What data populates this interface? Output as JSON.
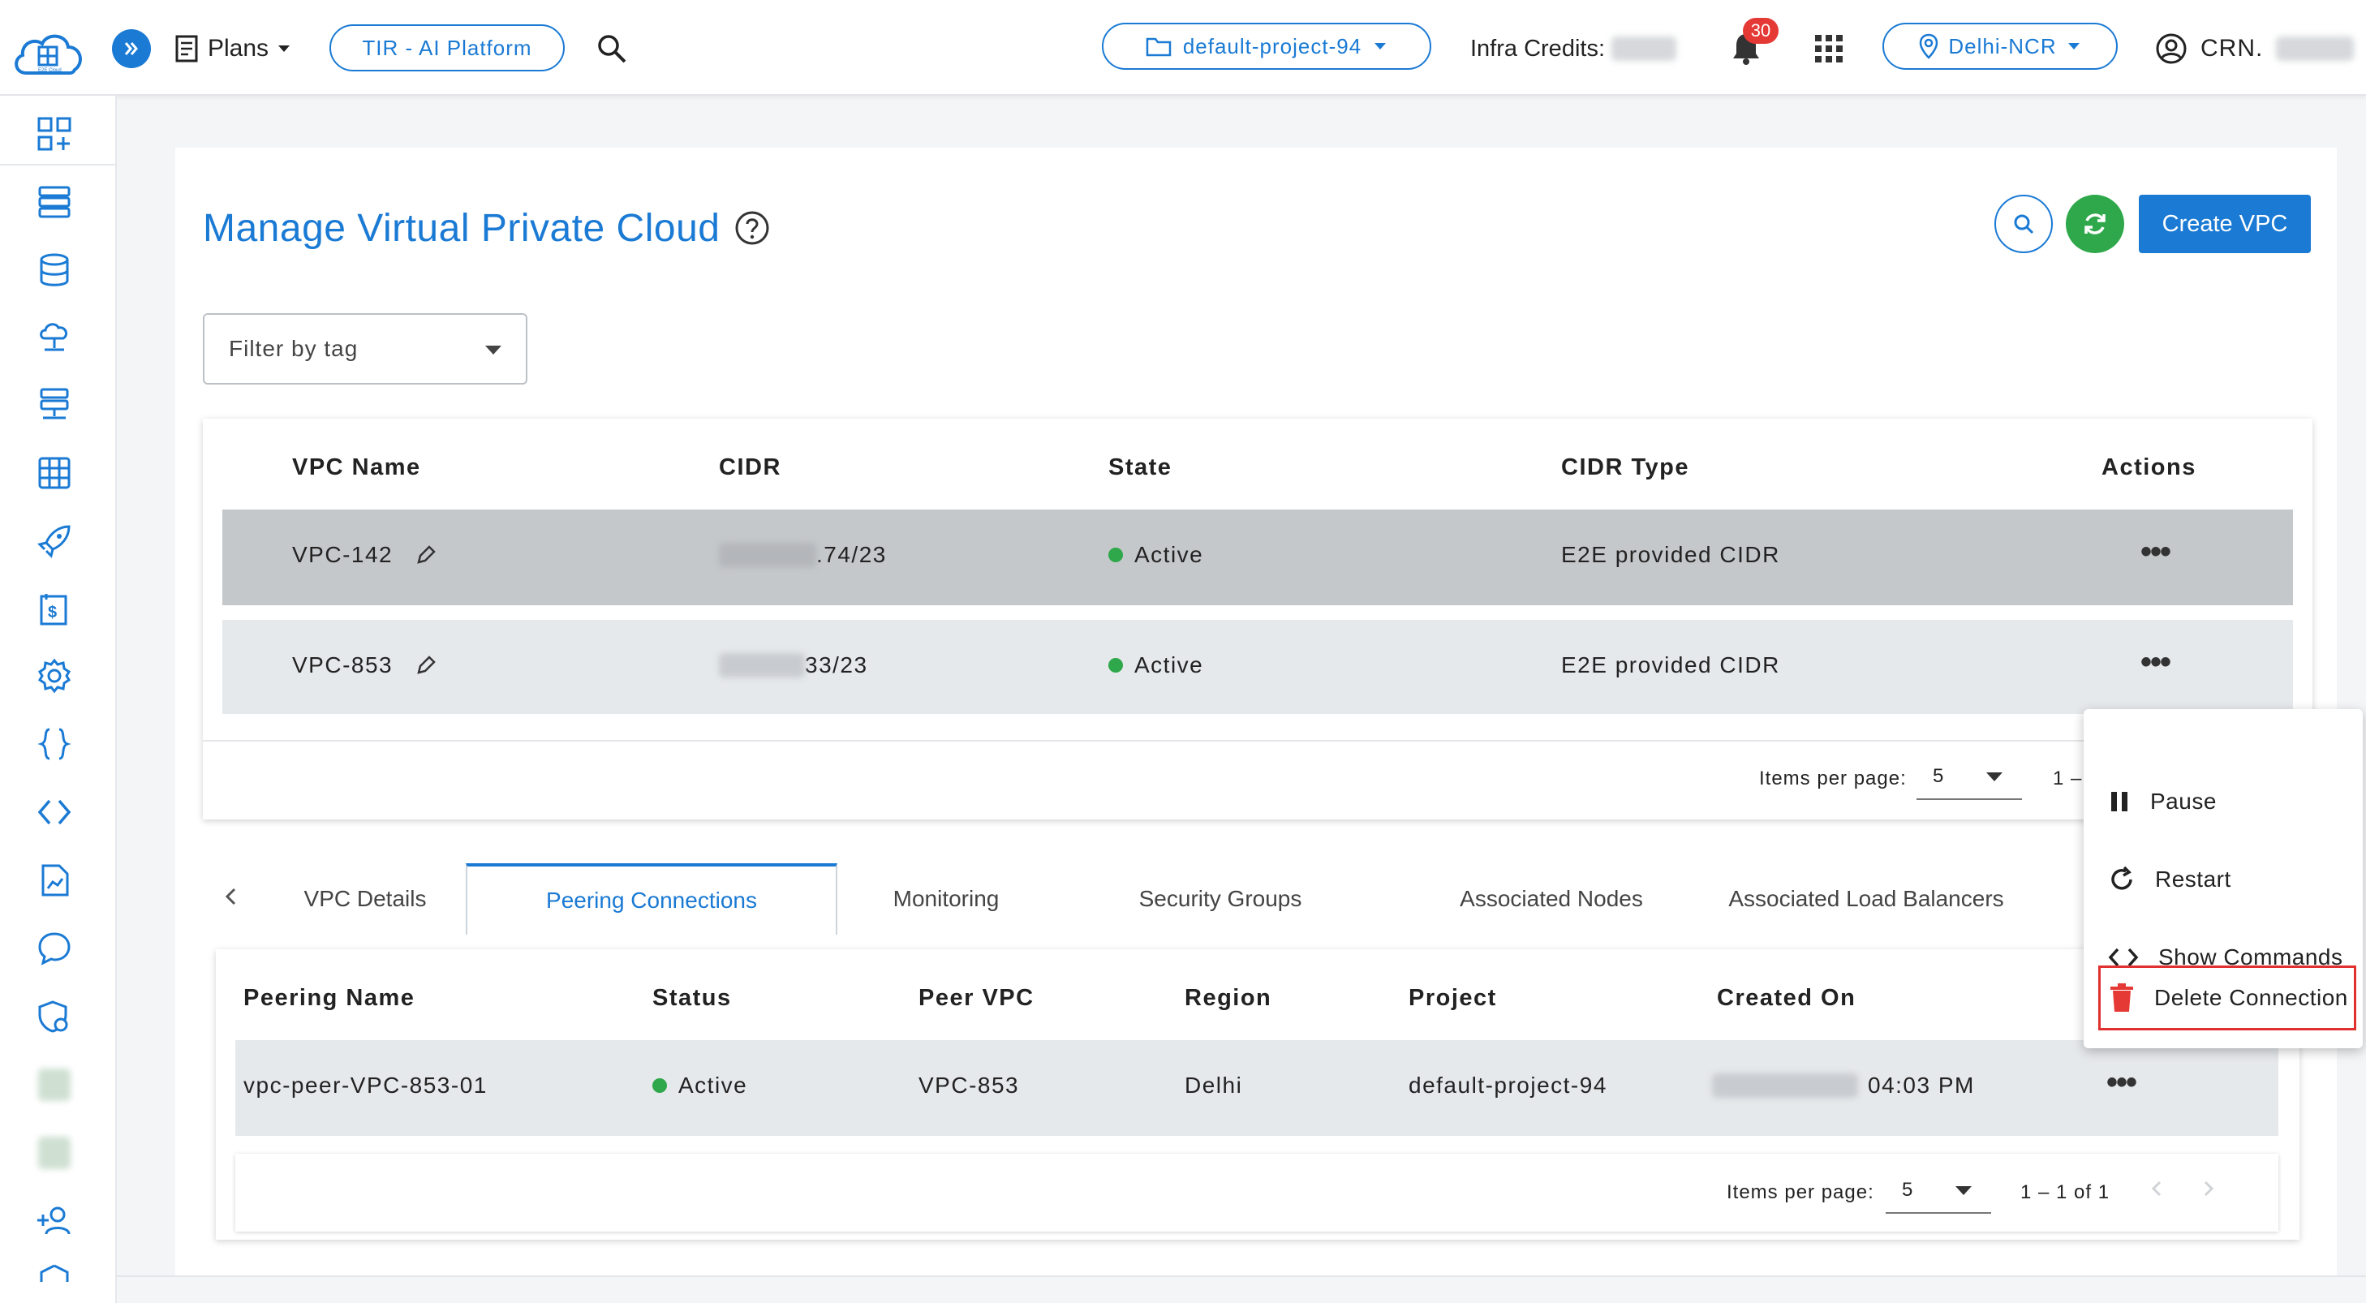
{
  "header": {
    "logo_text": "E2E Cloud",
    "plans_label": "Plans",
    "platform_button": "TIR - AI Platform",
    "project_selector": "default-project-94",
    "infra_credits_label": "Infra Credits:",
    "notification_count": "30",
    "region_selector": "Delhi-NCR",
    "crn_label": "CRN."
  },
  "page": {
    "title": "Manage Virtual Private Cloud",
    "create_button": "Create VPC",
    "filter_placeholder": "Filter by tag"
  },
  "vpc_table": {
    "columns": [
      "VPC Name",
      "CIDR",
      "State",
      "CIDR Type",
      "Actions"
    ],
    "rows": [
      {
        "name": "VPC-142",
        "cidr_suffix": ".74/23",
        "state": "Active",
        "cidr_type": "E2E provided CIDR",
        "actions": "•••"
      },
      {
        "name": "VPC-853",
        "cidr_suffix": "33/23",
        "state": "Active",
        "cidr_type": "E2E provided CIDR",
        "actions": "•••"
      }
    ],
    "items_per_page_label": "Items per page:",
    "items_per_page_value": "5",
    "range_text": "1 –"
  },
  "tabs": [
    "VPC Details",
    "Peering Connections",
    "Monitoring",
    "Security Groups",
    "Associated Nodes",
    "Associated Load Balancers"
  ],
  "active_tab": "Peering Connections",
  "peering_table": {
    "columns": [
      "Peering Name",
      "Status",
      "Peer VPC",
      "Region",
      "Project",
      "Created On"
    ],
    "rows": [
      {
        "name": "vpc-peer-VPC-853-01",
        "status": "Active",
        "peer_vpc": "VPC-853",
        "region": "Delhi",
        "project": "default-project-94",
        "created_time": "04:03 PM",
        "actions": "•••"
      }
    ],
    "items_per_page_label": "Items per page:",
    "items_per_page_value": "5",
    "range_text": "1 – 1 of 1"
  },
  "action_menu": {
    "items": [
      "Pause",
      "Restart",
      "Show Commands",
      "Delete Connection"
    ]
  },
  "colors": {
    "primary": "#1a7ad4",
    "success": "#2ea84a",
    "danger": "#e03030"
  }
}
